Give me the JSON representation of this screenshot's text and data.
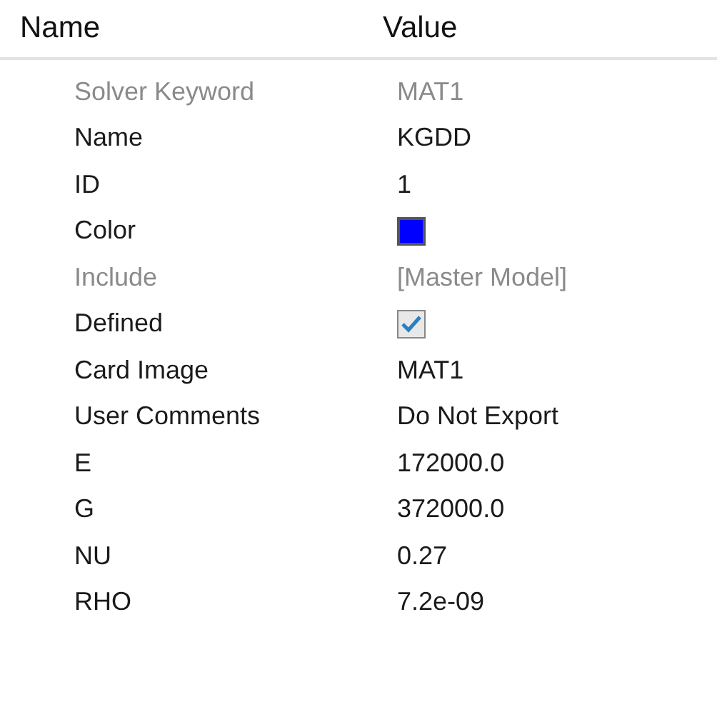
{
  "columns": [
    "Name",
    "Value"
  ],
  "rows": [
    {
      "name": "Solver Keyword",
      "kind": "text",
      "value": "MAT1",
      "disabled": true
    },
    {
      "name": "Name",
      "kind": "text",
      "value": "KGDD",
      "disabled": false
    },
    {
      "name": "ID",
      "kind": "text",
      "value": "1",
      "disabled": false
    },
    {
      "name": "Color",
      "kind": "color",
      "color": "#0000ff",
      "disabled": false
    },
    {
      "name": "Include",
      "kind": "text",
      "value": "[Master Model]",
      "disabled": true
    },
    {
      "name": "Defined",
      "kind": "checkbox",
      "checked": true,
      "disabled": false
    },
    {
      "name": "Card Image",
      "kind": "text",
      "value": "MAT1",
      "disabled": false
    },
    {
      "name": "User Comments",
      "kind": "text",
      "value": "Do Not Export",
      "disabled": false
    },
    {
      "name": "E",
      "kind": "text",
      "value": "172000.0",
      "disabled": false
    },
    {
      "name": "G",
      "kind": "text",
      "value": "372000.0",
      "disabled": false
    },
    {
      "name": "NU",
      "kind": "text",
      "value": "0.27",
      "disabled": false
    },
    {
      "name": "RHO",
      "kind": "text",
      "value": "7.2e-09",
      "disabled": false
    }
  ]
}
